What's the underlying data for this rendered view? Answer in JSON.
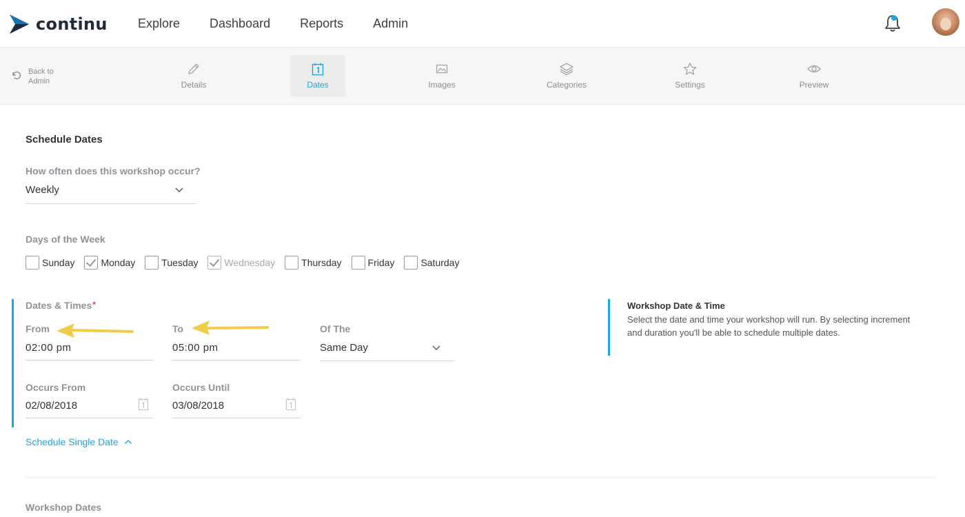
{
  "brand": {
    "name": "continu",
    "accent": "#18a9e0",
    "dark": "#1f2a3a"
  },
  "nav": {
    "items": [
      "Explore",
      "Dashboard",
      "Reports",
      "Admin"
    ]
  },
  "header": {
    "bell_icon": "bell-icon",
    "avatar": "user-avatar"
  },
  "subnav": {
    "back_label": "Back to Admin",
    "tabs": [
      {
        "label": "Details",
        "icon": "pencil-icon"
      },
      {
        "label": "Dates",
        "icon": "calendar-icon",
        "active": true
      },
      {
        "label": "Images",
        "icon": "image-icon"
      },
      {
        "label": "Categories",
        "icon": "layers-icon"
      },
      {
        "label": "Settings",
        "icon": "star-icon"
      },
      {
        "label": "Preview",
        "icon": "eye-icon"
      }
    ]
  },
  "schedule": {
    "title": "Schedule Dates",
    "frequency_label": "How often does this workshop occur?",
    "frequency_value": "Weekly",
    "days_label": "Days of the Week",
    "days": [
      {
        "label": "Sunday",
        "checked": false
      },
      {
        "label": "Monday",
        "checked": true
      },
      {
        "label": "Tuesday",
        "checked": false
      },
      {
        "label": "Wednesday",
        "checked": true,
        "disabled": true
      },
      {
        "label": "Thursday",
        "checked": false
      },
      {
        "label": "Friday",
        "checked": false
      },
      {
        "label": "Saturday",
        "checked": false
      }
    ],
    "dates_times_label": "Dates & Times",
    "required_mark": "*",
    "from_label": "From",
    "from_value": "02:00 pm",
    "to_label": "To",
    "to_value": "05:00 pm",
    "of_the_label": "Of The",
    "of_the_value": "Same Day",
    "occurs_from_label": "Occurs From",
    "occurs_from_value": "02/08/2018",
    "occurs_until_label": "Occurs Until",
    "occurs_until_value": "03/08/2018",
    "single_date_link": "Schedule Single Date"
  },
  "help": {
    "title": "Workshop Date & Time",
    "text": "Select the date and time your workshop will run. By selecting increment and duration you'll be able to schedule multiple dates."
  },
  "workshop_dates": {
    "title": "Workshop Dates"
  }
}
